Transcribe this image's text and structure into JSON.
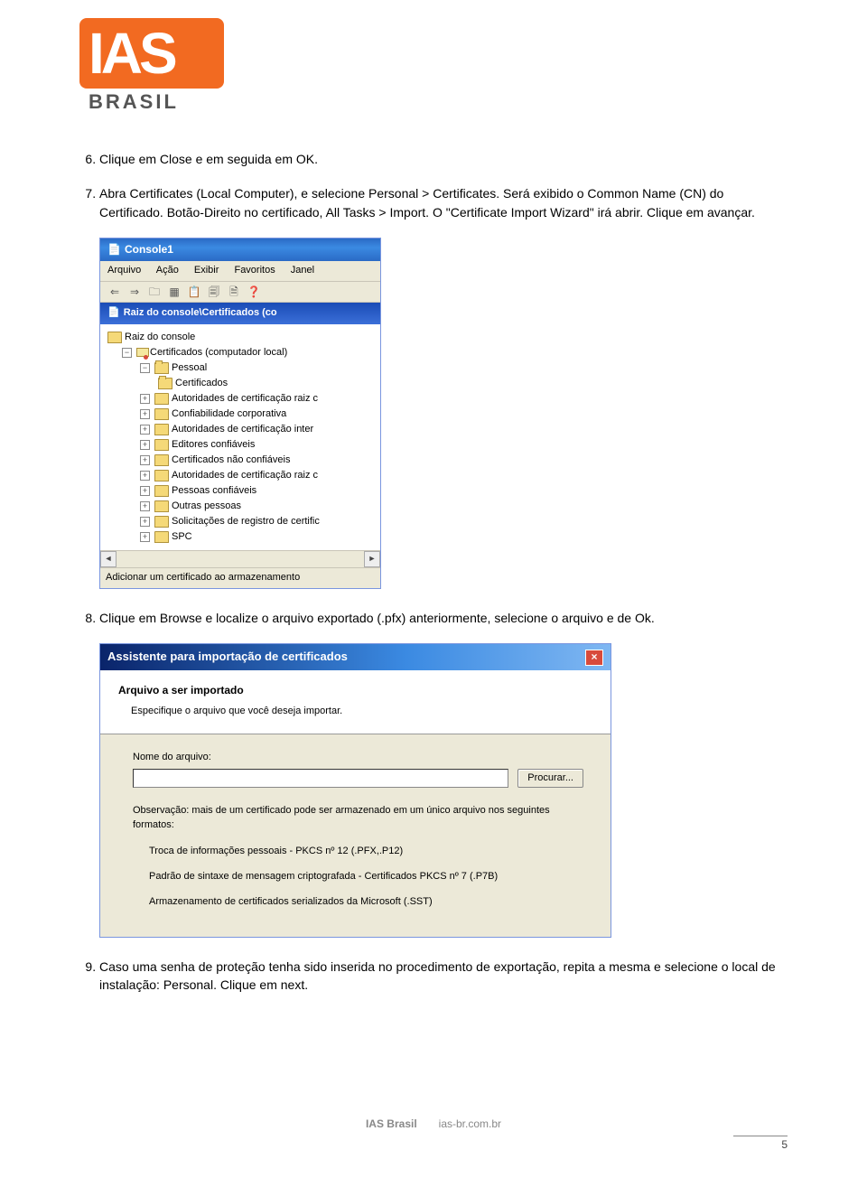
{
  "logo": {
    "main": "IAS",
    "sub": "BRASIL"
  },
  "steps": {
    "s6": "Clique em Close e em seguida em OK.",
    "s7": "Abra Certificates (Local Computer), e selecione Personal > Certificates. Será exibido o Common Name (CN) do Certificado. Botão-Direito no certificado, All Tasks > Import. O \"Certificate Import Wizard\" irá abrir. Clique em avançar.",
    "s8": "Clique em Browse e localize o arquivo exportado (.pfx) anteriormente, selecione o arquivo e de Ok.",
    "s9": "Caso uma senha de proteção tenha sido inserida no procedimento de exportação, repita a mesma e selecione o local de instalação: Personal. Clique em next."
  },
  "mmc": {
    "title": "Console1",
    "menu": {
      "m1": "Arquivo",
      "m2": "Ação",
      "m3": "Exibir",
      "m4": "Favoritos",
      "m5": "Janel"
    },
    "path": "Raiz do console\\Certificados (co",
    "tree": {
      "root": "Raiz do console",
      "certs": "Certificados (computador local)",
      "pessoal": "Pessoal",
      "pessoal_sub": "Certificados",
      "i1": "Autoridades de certificação raiz c",
      "i2": "Confiabilidade corporativa",
      "i3": "Autoridades de certificação inter",
      "i4": "Editores confiáveis",
      "i5": "Certificados não confiáveis",
      "i6": "Autoridades de certificação raiz c",
      "i7": "Pessoas confiáveis",
      "i8": "Outras pessoas",
      "i9": "Solicitações de registro de certific",
      "i10": "SPC"
    },
    "status": "Adicionar um certificado ao armazenamento"
  },
  "wizard": {
    "title": "Assistente para importação de certificados",
    "head": "Arquivo a ser importado",
    "sub": "Especifique o arquivo que você deseja importar.",
    "label_file": "Nome do arquivo:",
    "browse": "Procurar...",
    "note": "Observação: mais de um certificado pode ser armazenado em um único arquivo nos seguintes formatos:",
    "fmt1": "Troca de informações pessoais - PKCS nº 12 (.PFX,.P12)",
    "fmt2": "Padrão de sintaxe de mensagem criptografada - Certificados PKCS nº 7 (.P7B)",
    "fmt3": "Armazenamento de certificados serializados da Microsoft (.SST)"
  },
  "footer": {
    "brand": "IAS Brasil",
    "url": "ias-br.com.br",
    "page": "5"
  }
}
